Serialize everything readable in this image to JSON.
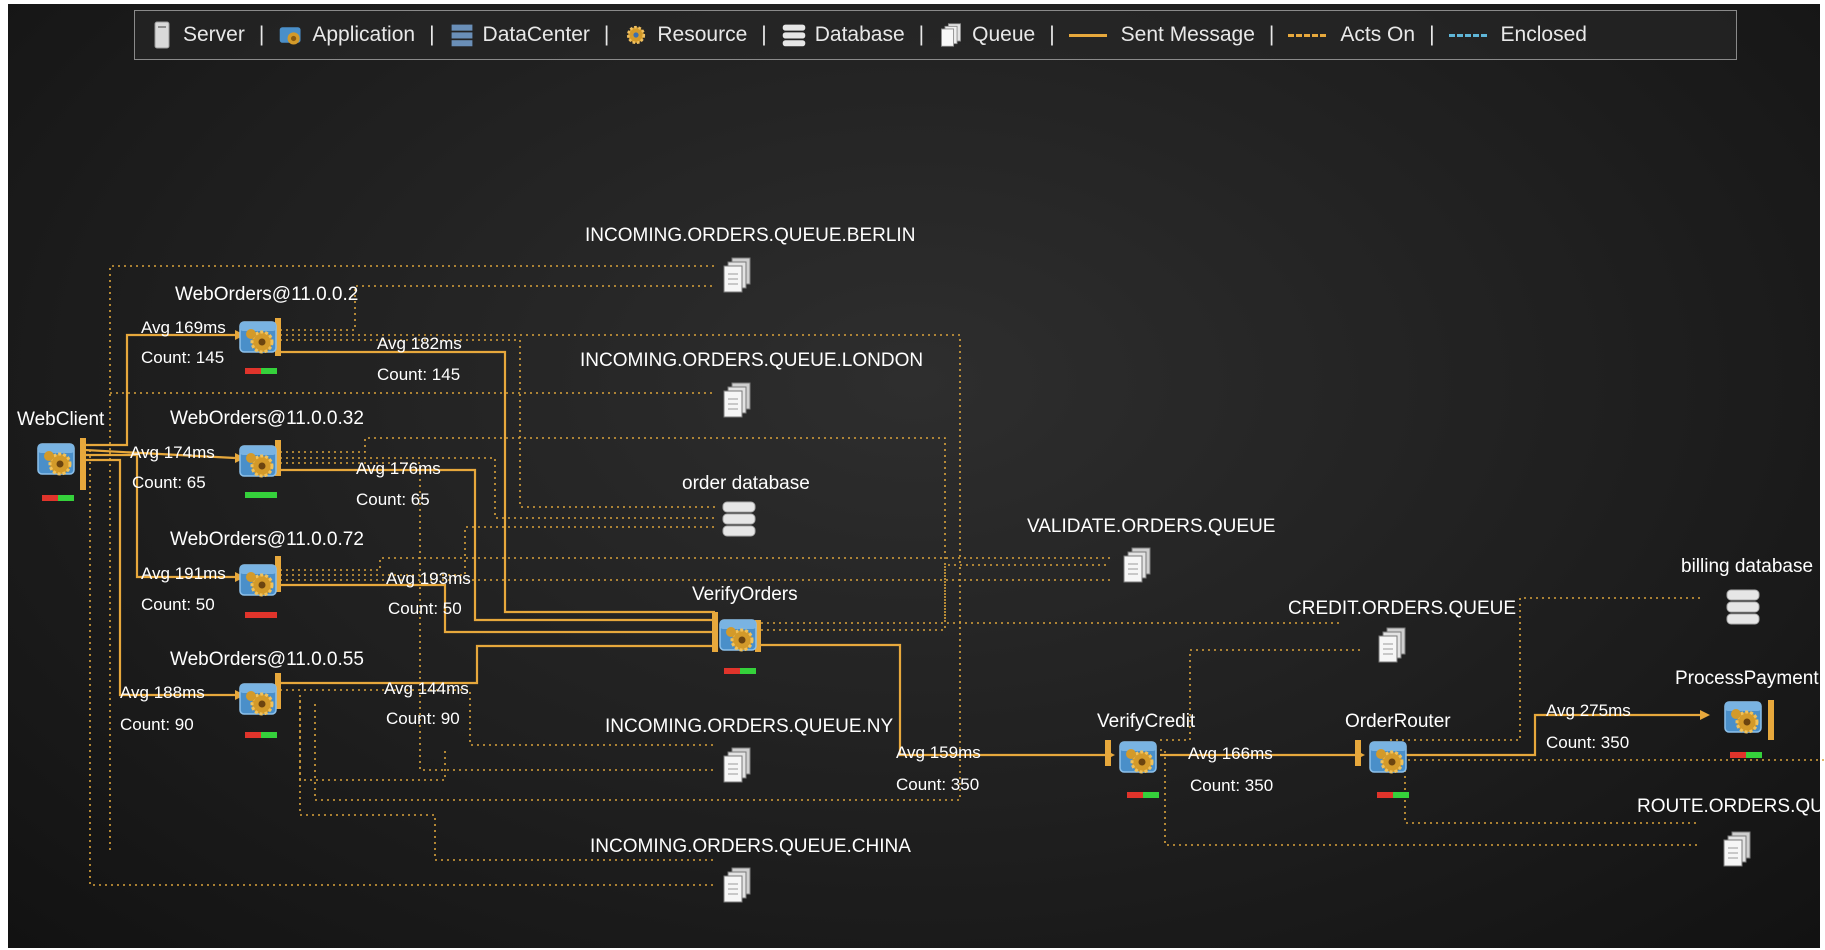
{
  "legend": {
    "server": "Server",
    "application": "Application",
    "datacenter": "DataCenter",
    "resource": "Resource",
    "database": "Database",
    "queue": "Queue",
    "sent_message": "Sent Message",
    "acts_on": "Acts On",
    "enclosed": "Enclosed",
    "sep": "|"
  },
  "colors": {
    "accent": "#e7a83c",
    "enclosed": "#5fb6d8",
    "status_red": "#e0342b",
    "status_green": "#35d13b"
  },
  "nodes": {
    "webclient": "WebClient",
    "wo2": "WebOrders@11.0.0.2",
    "wo32": "WebOrders@11.0.0.32",
    "wo72": "WebOrders@11.0.0.72",
    "wo55": "WebOrders@11.0.0.55",
    "q_berlin": "INCOMING.ORDERS.QUEUE.BERLIN",
    "q_london": "INCOMING.ORDERS.QUEUE.LONDON",
    "order_db": "order database",
    "validate_q": "VALIDATE.ORDERS.QUEUE",
    "verify_orders": "VerifyOrders",
    "q_ny": "INCOMING.ORDERS.QUEUE.NY",
    "q_china": "INCOMING.ORDERS.QUEUE.CHINA",
    "credit_q": "CREDIT.ORDERS.QUEUE",
    "verify_credit": "VerifyCredit",
    "order_router": "OrderRouter",
    "billing_db": "billing database",
    "process_payment": "ProcessPayment",
    "route_q": "ROUTE.ORDERS.QUE"
  },
  "edges": {
    "wc_wo2_avg": "Avg 169ms",
    "wc_wo2_count": "Count: 145",
    "wo2_vo_avg": "Avg 182ms",
    "wo2_vo_count": "Count: 145",
    "wc_wo32_avg": "Avg 174ms",
    "wc_wo32_count": "Count: 65",
    "wo32_vo_avg": "Avg 176ms",
    "wo32_vo_count": "Count: 65",
    "wc_wo72_avg": "Avg 191ms",
    "wc_wo72_count": "Count: 50",
    "wo72_vo_avg": "Avg 193ms",
    "wo72_vo_count": "Count: 50",
    "wc_wo55_avg": "Avg 188ms",
    "wc_wo55_count": "Count: 90",
    "wo55_vo_avg": "Avg 144ms",
    "wo55_vo_count": "Count: 90",
    "vo_vc_avg": "Avg 159ms",
    "vo_vc_count": "Count: 350",
    "vc_or_avg": "Avg 166ms",
    "vc_or_count": "Count: 350",
    "or_pp_avg": "Avg 275ms",
    "or_pp_count": "Count: 350"
  }
}
